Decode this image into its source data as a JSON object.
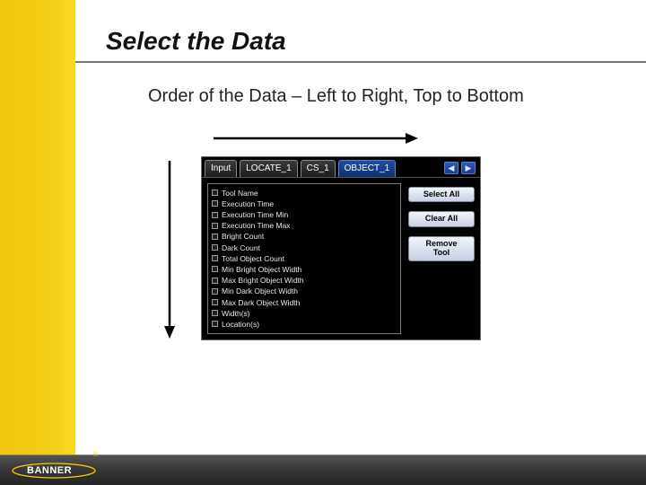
{
  "slide": {
    "title": "Select the Data",
    "subtitle": "Order of the Data – Left to Right, Top to Bottom"
  },
  "footer": {
    "brand": "BANNER",
    "trademark": "®"
  },
  "panel": {
    "tabs": {
      "input": "Input",
      "locate": "LOCATE_1",
      "cs": "CS_1",
      "object": "OBJECT_1"
    },
    "nav": {
      "prev": "◀",
      "next": "▶"
    },
    "list": [
      "Tool Name",
      "Execution Time",
      "Execution Time Min",
      "Execution Time Max",
      "Bright Count",
      "Dark Count",
      "Total Object Count",
      "Min Bright Object Width",
      "Max Bright Object Width",
      "Min Dark Object Width",
      "Max Dark Object Width",
      "Width(s)",
      "Location(s)"
    ],
    "buttons": {
      "select_all": "Select All",
      "clear_all": "Clear All",
      "remove_tool": "Remove\nTool"
    }
  }
}
